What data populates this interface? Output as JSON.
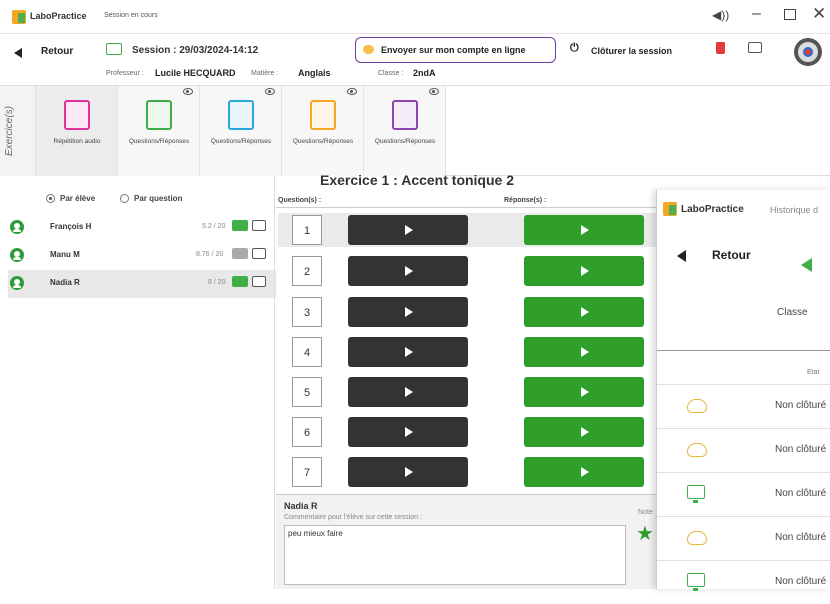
{
  "titlebar": {
    "app_name": "LaboPractice",
    "session_status": "Session en cours",
    "controls": [
      "volume-icon",
      "minimize-icon",
      "maximize-icon",
      "close-icon"
    ]
  },
  "header": {
    "back_label": "Retour",
    "session_label": "Session : 29/03/2024-14:12",
    "professor_prefix": "Professeur :",
    "professor_name": "Lucile HECQUARD",
    "subject_prefix": "Matière :",
    "subject_name": "Anglais",
    "class_prefix": "Classe :",
    "class_name": "2ndA",
    "send_button": "Envoyer sur mon compte en ligne",
    "close_session_button": "Clôturer la session"
  },
  "exercises": {
    "side_label": "Exercice(s)",
    "items": [
      {
        "label": "Répétition audio",
        "color": "#e0339a",
        "icon": "music-file-icon"
      },
      {
        "label": "Questions/Réponses",
        "color": "#3fae49",
        "icon": "document-icon"
      },
      {
        "label": "Questions/Réponses",
        "color": "#2aa7d8",
        "icon": "video-icon"
      },
      {
        "label": "Questions/Réponses",
        "color": "#f5a623",
        "icon": "image-icon"
      },
      {
        "label": "Questions/Réponses",
        "color": "#8e44ad",
        "icon": "music-file-icon"
      }
    ]
  },
  "view_mode": {
    "by_student": "Par élève",
    "by_question": "Par question",
    "selected": "Par élève"
  },
  "students": [
    {
      "name": "François H",
      "score": "5.2 / 20",
      "comment": true
    },
    {
      "name": "Manu M",
      "score": "8.76 / 20",
      "comment": false
    },
    {
      "name": "Nadia R",
      "score": "8 / 20",
      "comment": true
    }
  ],
  "exercise_title": "Exercice 1 : Accent tonique 2",
  "columns": {
    "questions": "Question(s) :",
    "answers": "Réponse(s) :"
  },
  "questions": [
    "1",
    "2",
    "3",
    "4",
    "5",
    "6",
    "7"
  ],
  "comment_panel": {
    "student_name": "Nadia R",
    "label": "Commentaire pour l'élève sur cette session :",
    "note_label": "Note",
    "comment_text": "peu mieux faire"
  },
  "history_window": {
    "app_name": "LaboPractice",
    "title": "Historique d",
    "back_label": "Retour",
    "class_label": "Classe",
    "state_header": "Etat",
    "rows": [
      {
        "icon": "cloud-icon",
        "status": "Non clôturé"
      },
      {
        "icon": "cloud-icon",
        "status": "Non clôturé"
      },
      {
        "icon": "monitor-icon",
        "status": "Non clôturé"
      },
      {
        "icon": "cloud-icon",
        "status": "Non clôturé"
      },
      {
        "icon": "monitor-icon",
        "status": "Non clôturé"
      }
    ]
  },
  "colors": {
    "accent_purple": "#6a3ea1",
    "green": "#2f9e2b",
    "dark": "#333333"
  }
}
